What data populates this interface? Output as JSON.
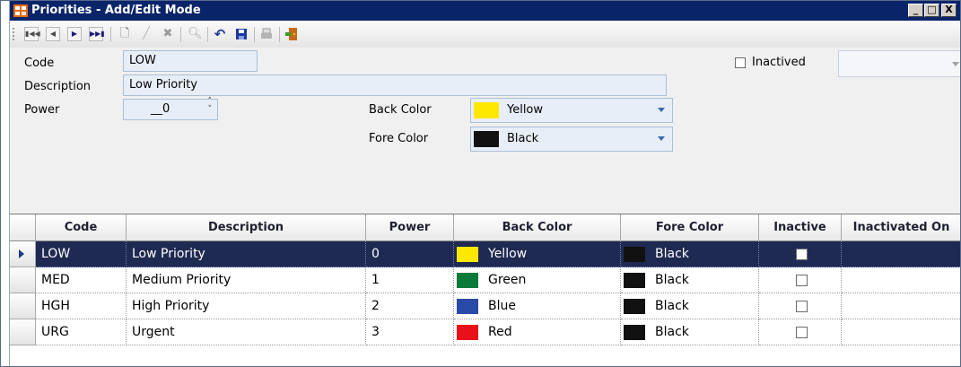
{
  "window": {
    "title": "Priorities - Add/Edit Mode",
    "controls": [
      "_",
      "□",
      "X"
    ]
  },
  "toolbar": {
    "nav_buttons": [
      "first-record-icon",
      "previous-record-icon",
      "next-record-icon",
      "last-record-icon"
    ],
    "action_icons": [
      "new-document-icon",
      "edit-pencil-icon",
      "delete-x-icon",
      "search-icon",
      "undo-icon",
      "save-disk-icon",
      "print-icon",
      "exit-door-icon"
    ]
  },
  "form": {
    "code_label": "Code",
    "code_value": "LOW",
    "description_label": "Description",
    "description_value": "Low Priority",
    "power_label": "Power",
    "power_value": "__0",
    "back_color_label": "Back Color",
    "back_color_value": "Yellow",
    "back_color_swatch": "#ffe800",
    "fore_color_label": "Fore Color",
    "fore_color_value": "Black",
    "fore_color_swatch": "#111111",
    "inactived_label": "Inactived",
    "inactived_checked": false
  },
  "grid": {
    "columns": [
      "Code",
      "Description",
      "Power",
      "Back Color",
      "Fore Color",
      "Inactive",
      "Inactivated On"
    ],
    "rows": [
      {
        "code": "LOW",
        "description": "Low Priority",
        "power": "0",
        "back_color": "Yellow",
        "back_swatch": "#ffe800",
        "fore_color": "Black",
        "fore_swatch": "#111111",
        "inactive": false,
        "selected": true
      },
      {
        "code": "MED",
        "description": "Medium Priority",
        "power": "1",
        "back_color": "Green",
        "back_swatch": "#0a7a3a",
        "fore_color": "Black",
        "fore_swatch": "#111111",
        "inactive": false,
        "selected": false
      },
      {
        "code": "HGH",
        "description": "High Priority",
        "power": "2",
        "back_color": "Blue",
        "back_swatch": "#2a4aa8",
        "fore_color": "Black",
        "fore_swatch": "#111111",
        "inactive": false,
        "selected": false
      },
      {
        "code": "URG",
        "description": "Urgent",
        "power": "3",
        "back_color": "Red",
        "back_swatch": "#e8101a",
        "fore_color": "Black",
        "fore_swatch": "#111111",
        "inactive": false,
        "selected": false
      }
    ]
  }
}
